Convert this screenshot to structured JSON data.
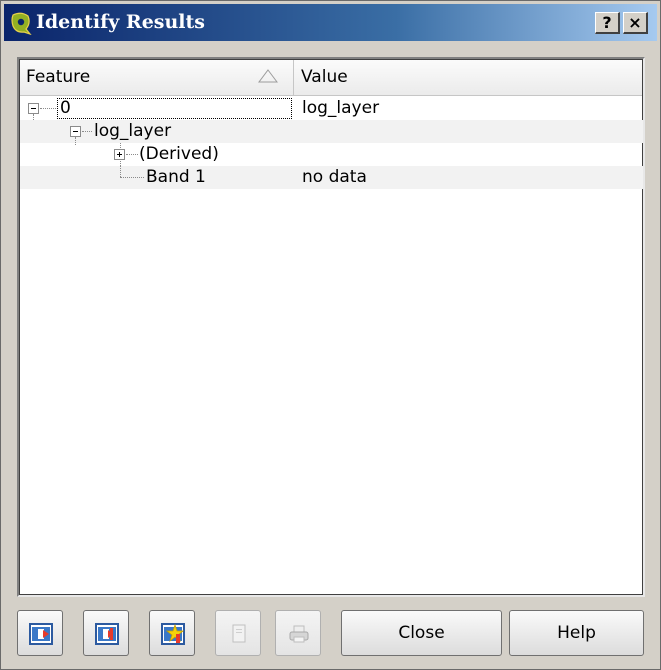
{
  "window": {
    "title": "Identify Results",
    "help_button": "?",
    "close_button": "×"
  },
  "tree": {
    "columns": [
      "Feature",
      "Value"
    ],
    "rows": [
      {
        "feature": "0",
        "value": "log_layer"
      },
      {
        "feature": "log_layer",
        "value": ""
      },
      {
        "feature": "(Derived)",
        "value": ""
      },
      {
        "feature": "Band 1",
        "value": "no data"
      }
    ]
  },
  "toolbar": {
    "expand_icon": "expand-tree-icon",
    "collapse_icon": "collapse-tree-icon",
    "new_feature_icon": "highlight-icon",
    "copy_icon": "copy-icon",
    "print_icon": "print-icon",
    "close_label": "Close",
    "help_label": "Help"
  }
}
